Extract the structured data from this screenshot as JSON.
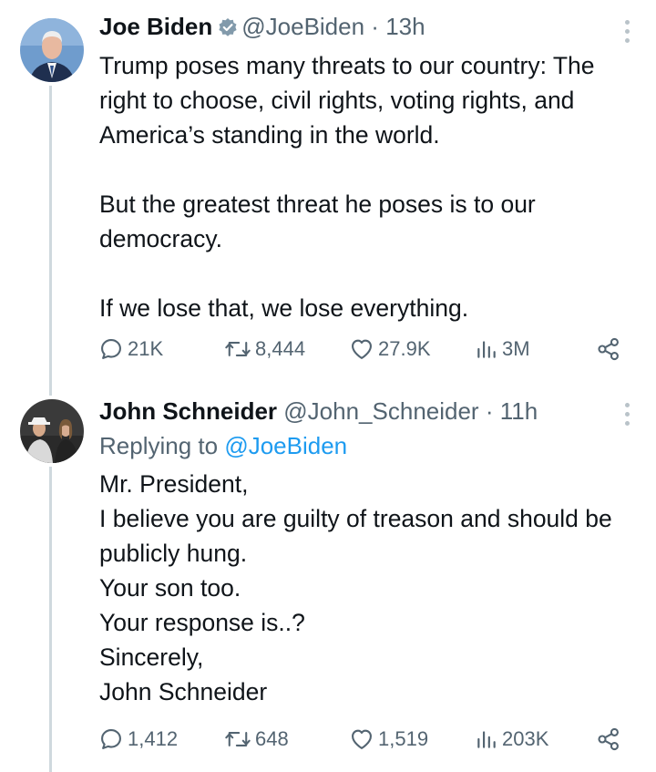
{
  "tweets": [
    {
      "name": "Joe Biden",
      "handle": "@JoeBiden",
      "time": "13h",
      "text": "Trump poses many threats to our country: The right to choose, civil rights, voting rights, and America’s standing in the world.\n\nBut the greatest threat he poses is to our democracy.\n\nIf we lose that, we lose everything.",
      "stats": {
        "replies": "21K",
        "retweets": "8,444",
        "likes": "27.9K",
        "views": "3M"
      }
    },
    {
      "name": "John Schneider",
      "handle": "@John_Schneider",
      "time": "11h",
      "replying_label": "Replying to",
      "replying_handle": "@JoeBiden",
      "text": "Mr. President,\nI believe you are guilty of treason and should be publicly hung.\nYour son too.\nYour response is..?\nSincerely,\nJohn Schneider",
      "stats": {
        "replies": "1,412",
        "retweets": "648",
        "likes": "1,519",
        "views": "203K"
      }
    }
  ],
  "separator": "·",
  "colors": {
    "text": "#0f1419",
    "secondary": "#536471",
    "link": "#1d9bf0",
    "thread_line": "#cfd9de",
    "verified": "#829aab"
  }
}
